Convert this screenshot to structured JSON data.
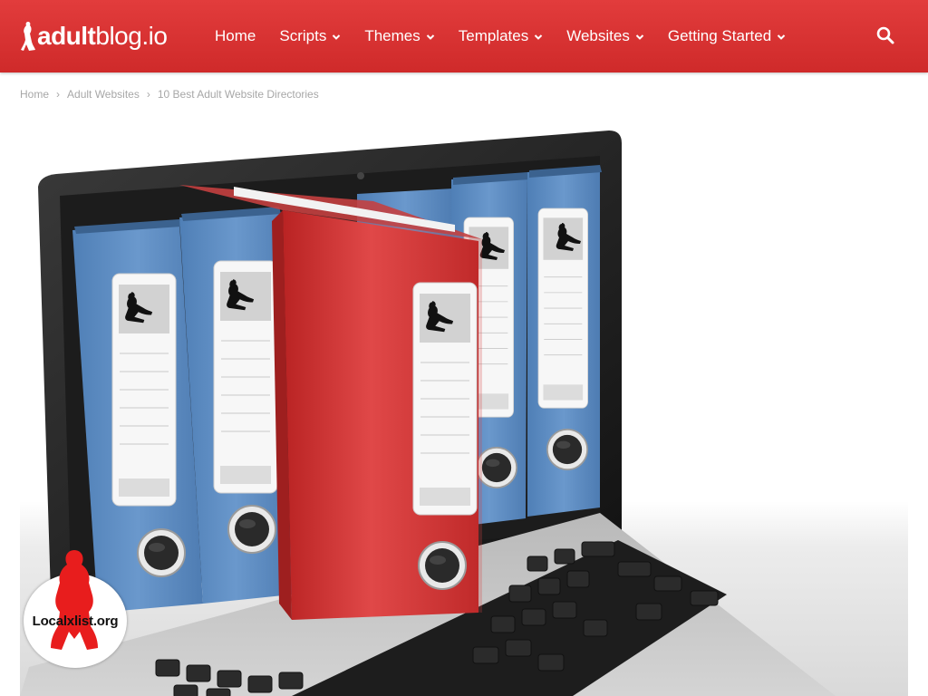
{
  "header": {
    "logo": {
      "bold": "adult",
      "light": "blog.io"
    },
    "nav": [
      {
        "label": "Home",
        "has_dropdown": false
      },
      {
        "label": "Scripts",
        "has_dropdown": true
      },
      {
        "label": "Themes",
        "has_dropdown": true
      },
      {
        "label": "Templates",
        "has_dropdown": true
      },
      {
        "label": "Websites",
        "has_dropdown": true
      },
      {
        "label": "Getting Started",
        "has_dropdown": true
      }
    ],
    "search_icon": "search-icon"
  },
  "breadcrumb": {
    "items": [
      "Home",
      "Adult Websites",
      "10 Best Adult Website Directories"
    ],
    "separator": "›"
  },
  "badge": {
    "label": "Localxlist.org"
  },
  "colors": {
    "brand_red": "#d93333",
    "binder_blue": "#5f8fc5",
    "binder_red": "#d93a3a"
  }
}
